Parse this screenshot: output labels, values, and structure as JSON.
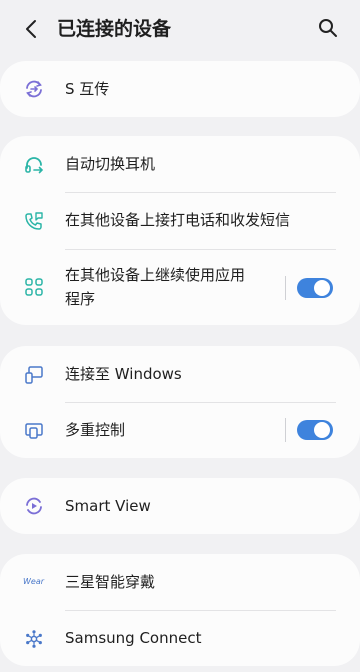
{
  "header": {
    "title": "已连接的设备"
  },
  "items": {
    "s_transfer": {
      "label": "S 互传"
    },
    "auto_switch": {
      "label": "自动切换耳机"
    },
    "calls": {
      "label": "在其他设备上接打电话和收发短信"
    },
    "continue_apps": {
      "label_line1": "在其他设备上继续使用应用",
      "label_line2": "程序",
      "toggle_on": true
    },
    "windows": {
      "label": "连接至 Windows"
    },
    "multi_control": {
      "label": "多重控制",
      "toggle_on": true
    },
    "smart_view": {
      "label": "Smart View"
    },
    "wearables": {
      "label": "三星智能穿戴",
      "icon_text": "Wear"
    },
    "samsung_connect": {
      "label": "Samsung Connect"
    }
  },
  "colors": {
    "accent": "#3e83dd",
    "icon_purple": "#7b6fd6",
    "icon_teal": "#2bb5a7",
    "icon_blue": "#4a78c9"
  }
}
